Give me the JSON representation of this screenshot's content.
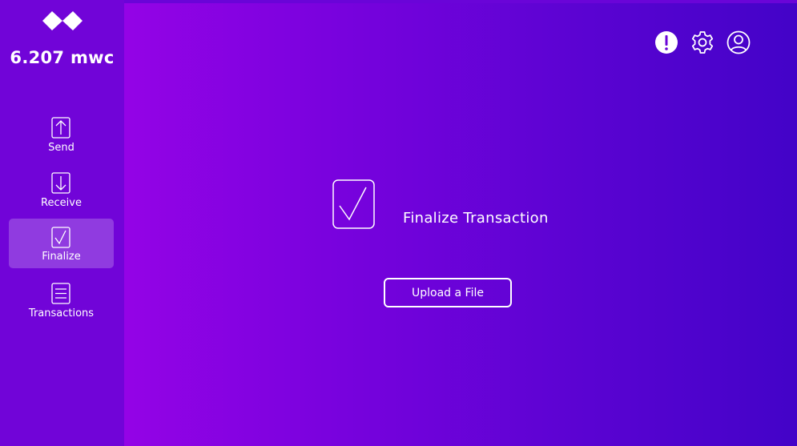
{
  "sidebar": {
    "balance": "6.207 mwc",
    "items": [
      {
        "label": "Send",
        "icon": "arrow-up-icon"
      },
      {
        "label": "Receive",
        "icon": "arrow-down-icon"
      },
      {
        "label": "Finalize",
        "icon": "checkbox-icon",
        "active": true
      },
      {
        "label": "Transactions",
        "icon": "list-icon"
      }
    ]
  },
  "header": {
    "icons": [
      "alert-icon",
      "gear-icon",
      "user-icon"
    ]
  },
  "main": {
    "title": "Finalize Transaction",
    "upload_label": "Upload a File"
  },
  "colors": {
    "sidebar_bg": "#7104d8",
    "gradient_start": "#9403e6",
    "gradient_end": "#4303c8",
    "text": "#ffffff"
  }
}
